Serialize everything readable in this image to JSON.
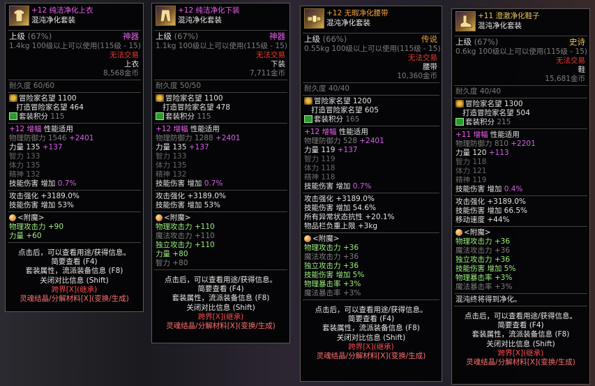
{
  "tooltips": [
    {
      "name_prefix": "+12",
      "name": "纯洁净化上衣",
      "set_name": "混沌净化套装",
      "grade": "上级",
      "grade_pct": "(67%)",
      "rarity": "神器",
      "weight": "1.4kg",
      "level_req": "100级以上可以使用(115级 - 15)",
      "trade": "无法交易",
      "slot": "上衣",
      "price": "8,568金币",
      "durability": "耐久度 60/60",
      "fame_label": "冒险家名望",
      "fame": "1100",
      "forge_fame_label": "打造冒险家名望",
      "forge_fame": "464",
      "set_points_label": "套装积分",
      "set_points": "115",
      "amp_label": "增幅",
      "amp_suffix": "性能适用",
      "phys_def_label": "物理防御力",
      "phys_def": "1546",
      "phys_def_bonus": "+2401",
      "str_label": "力量",
      "str": "135",
      "str_bonus": "+137",
      "int": "智力 133",
      "vit": "体力 135",
      "spr": "精神 132",
      "skill_dmg_label": "技能伤害",
      "skill_dmg_text": "增加",
      "skill_dmg_val": "0.7%",
      "atk_boost_label": "攻击强化",
      "atk_boost": "+3189.0%",
      "skill_dmg2_label": "技能伤害",
      "skill_dmg2": "增加 53%",
      "enchant_label": "<附魔>",
      "enchant_lines": [
        {
          "l": "物理攻击力",
          "v": "+90"
        },
        {
          "l": "力量",
          "v": "+60"
        }
      ],
      "footer": [
        "点击后，可以查看用途/获得信息。",
        "简要查看 (F4)",
        "套装属性，流派装备信息 (F8)",
        "关闭对比信息 (Shift)"
      ],
      "footer_red": [
        "跨界[X](继承)",
        "灵魂结晶/分解材料[X](变换/生成)"
      ]
    },
    {
      "name_prefix": "+12",
      "name": "纯洁净化下装",
      "set_name": "混沌净化套装",
      "grade": "上级",
      "grade_pct": "(67%)",
      "rarity": "神器",
      "weight": "1.1kg",
      "level_req": "100级以上可以使用(115级 - 15)",
      "trade": "无法交易",
      "slot": "下装",
      "price": "7,711金币",
      "durability": "耐久度 50/50",
      "fame_label": "冒险家名望",
      "fame": "1100",
      "forge_fame_label": "打造冒险家名望",
      "forge_fame": "478",
      "set_points_label": "套装积分",
      "set_points": "115",
      "amp_label": "增幅",
      "amp_suffix": "性能适用",
      "phys_def_label": "物理防御力",
      "phys_def": "1288",
      "phys_def_bonus": "+2401",
      "str_label": "力量",
      "str": "135",
      "str_bonus": "+137",
      "int": "智力 133",
      "vit": "体力 135",
      "spr": "精神 132",
      "skill_dmg_label": "技能伤害",
      "skill_dmg_text": "增加",
      "skill_dmg_val": "0.7%",
      "atk_boost_label": "攻击强化",
      "atk_boost": "+3189.0%",
      "skill_dmg2_label": "技能伤害",
      "skill_dmg2": "增加 53%",
      "enchant_label": "<附魔>",
      "enchant_lines": [
        {
          "l": "物理攻击力",
          "v": "+110"
        },
        {
          "l": "魔法攻击力",
          "v": "+110"
        },
        {
          "l": "独立攻击力",
          "v": "+110"
        },
        {
          "l": "力量",
          "v": "+80"
        },
        {
          "l": "智力",
          "v": "+80"
        }
      ],
      "footer": [
        "点击后，可以查看用途/获得信息。",
        "简要查看 (F4)",
        "套装属性，流派装备信息 (F8)",
        "关闭对比信息 (Shift)"
      ],
      "footer_red": [
        "跨界[X](继承)",
        "灵魂结晶/分解材料[X](变换/生成)"
      ]
    },
    {
      "name_prefix": "+12",
      "name": "无暇净化腰带",
      "set_name": "混沌净化套装",
      "grade": "上级",
      "grade_pct": "(66%)",
      "rarity": "传说",
      "weight": "0.55kg",
      "level_req": "100级以上可以使用(115级 - 15)",
      "trade": "无法交易",
      "slot": "腰带",
      "price": "10,360金币",
      "durability": "耐久度 40/40",
      "fame_label": "冒险家名望",
      "fame": "1200",
      "forge_fame_label": "打造冒险家名望",
      "forge_fame": "605",
      "set_points_label": "套装积分",
      "set_points": "165",
      "amp_label": "增幅",
      "amp_suffix": "性能适用",
      "phys_def_label": "物理防御力",
      "phys_def": "528",
      "phys_def_bonus": "+2401",
      "str_label": "力量",
      "str": "119",
      "str_bonus": "+137",
      "int": "智力 119",
      "vit": "体力 118",
      "spr": "精神 118",
      "skill_dmg_label": "技能伤害",
      "skill_dmg_text": "增加",
      "skill_dmg_val": "0.7%",
      "atk_boost_label": "攻击强化",
      "atk_boost": "+3189.0%",
      "skill_dmg2_label": "技能伤害",
      "skill_dmg2": "增加 54.6%",
      "extra_lines": [
        "所有异常状态抗性 +20.1%",
        "物品栏负重上限 +3kg"
      ],
      "enchant_label": "<附魔>",
      "enchant_lines": [
        {
          "l": "物理攻击力",
          "v": "+36"
        },
        {
          "l": "魔法攻击力",
          "v": "+36"
        },
        {
          "l": "独立攻击力",
          "v": "+36"
        },
        {
          "l": "技能伤害",
          "v": "增加 5%"
        },
        {
          "l": "物理暴击率",
          "v": "+3%"
        },
        {
          "l": "魔法暴击率",
          "v": "+3%"
        }
      ],
      "footer": [
        "点击后，可以查看用途/获得信息。",
        "简要查看 (F4)",
        "套装属性，流派装备信息 (F8)",
        "关闭对比信息 (Shift)"
      ],
      "footer_red": [
        "跨界[X](继承)",
        "灵魂结晶/分解材料[X](变换/生成)"
      ]
    },
    {
      "name_prefix": "+11",
      "name": "澄澈净化鞋子",
      "set_name": "混沌净化套装",
      "grade": "上级",
      "grade_pct": "(67%)",
      "rarity": "史诗",
      "weight": "0.6kg",
      "level_req": "100级以上可以使用(115级 - 15)",
      "trade": "无法交易",
      "slot": "鞋",
      "price": "15,681金币",
      "durability": "耐久度 40/40",
      "fame_label": "冒险家名望",
      "fame": "1300",
      "forge_fame_label": "打造冒险家名望",
      "forge_fame": "504",
      "set_points_label": "套装积分",
      "set_points": "215",
      "amp_label": "增幅",
      "amp_suffix": "性能适用",
      "phys_def_label": "物理防御力",
      "phys_def": "810",
      "phys_def_bonus": "+2201",
      "str_label": "力量",
      "str": "120",
      "str_bonus": "+113",
      "int": "智力 118",
      "vit": "体力 121",
      "spr": "精神 119",
      "skill_dmg_label": "技能伤害",
      "skill_dmg_text": "增加",
      "skill_dmg_val": "0.4%",
      "atk_boost_label": "攻击强化",
      "atk_boost": "+3189.0%",
      "skill_dmg2_label": "技能伤害",
      "skill_dmg2": "增加 66.5%",
      "extra_lines": [
        "移动速度 +44%"
      ],
      "enchant_label": "<附魔>",
      "enchant_lines": [
        {
          "l": "物理攻击力",
          "v": "+36"
        },
        {
          "l": "魔法攻击力",
          "v": "+36"
        },
        {
          "l": "独立攻击力",
          "v": "+36"
        },
        {
          "l": "技能伤害",
          "v": "增加 5%"
        },
        {
          "l": "物理暴击率",
          "v": "+3%"
        },
        {
          "l": "魔法暴击率",
          "v": "+3%"
        }
      ],
      "note": "混沌终将得到净化。",
      "footer": [
        "点击后，可以查看用途/获得信息。",
        "简要查看 (F4)",
        "套装属性，流派装备信息 (F8)",
        "关闭对比信息 (Shift)"
      ],
      "footer_red": [
        "跨界[X](继承)",
        "灵魂结晶/分解材料[X](变换/生成)"
      ]
    }
  ],
  "colors": {
    "amp": "#ee5cf0",
    "green_bonus": "#7ce07c",
    "rarity_artifact": "#ee5cf0",
    "rarity_legend": "#f0a238",
    "rarity_epic": "#e8c45a",
    "untradeable": "#ee3a2c"
  },
  "icons": [
    "top-armor-icon",
    "pants-armor-icon",
    "belt-armor-icon",
    "shoes-armor-icon"
  ]
}
